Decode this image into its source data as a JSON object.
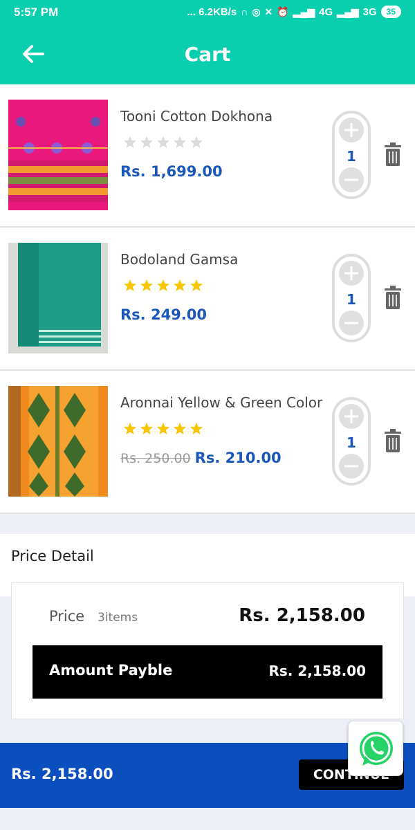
{
  "status_bar": {
    "time": "5:57 PM",
    "indicators": "... 6.2KB/s",
    "network1": "4G",
    "network2": "3G",
    "battery": "35"
  },
  "app_bar": {
    "title": "Cart",
    "back_icon": "back-arrow-icon"
  },
  "colors": {
    "primary": "#0acfaf",
    "price": "#1b57b8",
    "star": "#f7c600",
    "bottom_bar": "#0b4fbf"
  },
  "items": [
    {
      "name": "Tooni Cotton Dokhona",
      "rating": 0,
      "old_price": "",
      "price": "Rs. 1,699.00",
      "quantity": "1"
    },
    {
      "name": "Bodoland Gamsa",
      "rating": 5,
      "old_price": "",
      "price": "Rs. 249.00",
      "quantity": "1"
    },
    {
      "name": "Aronnai Yellow & Green Color",
      "rating": 5,
      "old_price": "Rs. 250.00",
      "price": "Rs. 210.00",
      "quantity": "1"
    }
  ],
  "price_detail": {
    "title": "Price Detail",
    "price_label": "Price",
    "item_count": "3items",
    "price_value": "Rs. 2,158.00",
    "amount_label": "Amount Payble",
    "amount_value": "Rs. 2,158.00"
  },
  "bottom_bar": {
    "total": "Rs. 2,158.00",
    "continue_label": "CONTINUE"
  }
}
